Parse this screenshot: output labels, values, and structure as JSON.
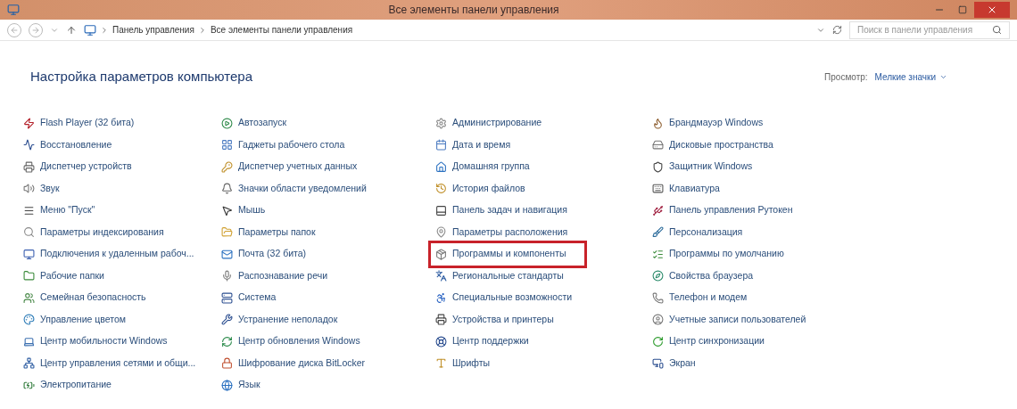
{
  "window": {
    "title": "Все элементы панели управления"
  },
  "address_bar": {
    "breadcrumb": [
      "Панель управления",
      "Все элементы панели управления"
    ],
    "search": {
      "placeholder": "Поиск в панели управления"
    }
  },
  "header": {
    "title": "Настройка параметров компьютера",
    "view_label": "Просмотр:",
    "view_value": "Мелкие значки"
  },
  "columns": [
    [
      {
        "label": "Flash Player (32 бита)",
        "highlighted": false
      },
      {
        "label": "Восстановление",
        "highlighted": false
      },
      {
        "label": "Диспетчер устройств",
        "highlighted": false
      },
      {
        "label": "Звук",
        "highlighted": false
      },
      {
        "label": "Меню \"Пуск\"",
        "highlighted": false
      },
      {
        "label": "Параметры индексирования",
        "highlighted": false
      },
      {
        "label": "Подключения к удаленным рабоч...",
        "highlighted": false
      },
      {
        "label": "Рабочие папки",
        "highlighted": false
      },
      {
        "label": "Семейная безопасность",
        "highlighted": false
      },
      {
        "label": "Управление цветом",
        "highlighted": false
      },
      {
        "label": "Центр мобильности Windows",
        "highlighted": false
      },
      {
        "label": "Центр управления сетями и общи...",
        "highlighted": false
      },
      {
        "label": "Электропитание",
        "highlighted": false
      }
    ],
    [
      {
        "label": "Автозапуск",
        "highlighted": false
      },
      {
        "label": "Гаджеты рабочего стола",
        "highlighted": false
      },
      {
        "label": "Диспетчер учетных данных",
        "highlighted": false
      },
      {
        "label": "Значки области уведомлений",
        "highlighted": false
      },
      {
        "label": "Мышь",
        "highlighted": false
      },
      {
        "label": "Параметры папок",
        "highlighted": false
      },
      {
        "label": "Почта (32 бита)",
        "highlighted": false
      },
      {
        "label": "Распознавание речи",
        "highlighted": false
      },
      {
        "label": "Система",
        "highlighted": false
      },
      {
        "label": "Устранение неполадок",
        "highlighted": false
      },
      {
        "label": "Центр обновления Windows",
        "highlighted": false
      },
      {
        "label": "Шифрование диска BitLocker",
        "highlighted": false
      },
      {
        "label": "Язык",
        "highlighted": false
      }
    ],
    [
      {
        "label": "Администрирование",
        "highlighted": false
      },
      {
        "label": "Дата и время",
        "highlighted": false
      },
      {
        "label": "Домашняя группа",
        "highlighted": false
      },
      {
        "label": "История файлов",
        "highlighted": false
      },
      {
        "label": "Панель задач и навигация",
        "highlighted": false
      },
      {
        "label": "Параметры расположения",
        "highlighted": false
      },
      {
        "label": "Программы и компоненты",
        "highlighted": true
      },
      {
        "label": "Региональные стандарты",
        "highlighted": false
      },
      {
        "label": "Специальные возможности",
        "highlighted": false
      },
      {
        "label": "Устройства и принтеры",
        "highlighted": false
      },
      {
        "label": "Центр поддержки",
        "highlighted": false
      },
      {
        "label": "Шрифты",
        "highlighted": false
      }
    ],
    [
      {
        "label": "Брандмауэр Windows",
        "highlighted": false
      },
      {
        "label": "Дисковые пространства",
        "highlighted": false
      },
      {
        "label": "Защитник Windows",
        "highlighted": false
      },
      {
        "label": "Клавиатура",
        "highlighted": false
      },
      {
        "label": "Панель управления Рутокен",
        "highlighted": false
      },
      {
        "label": "Персонализация",
        "highlighted": false
      },
      {
        "label": "Программы по умолчанию",
        "highlighted": false
      },
      {
        "label": "Свойства браузера",
        "highlighted": false
      },
      {
        "label": "Телефон и модем",
        "highlighted": false
      },
      {
        "label": "Учетные записи пользователей",
        "highlighted": false
      },
      {
        "label": "Центр синхронизации",
        "highlighted": false
      },
      {
        "label": "Экран",
        "highlighted": false
      }
    ]
  ]
}
